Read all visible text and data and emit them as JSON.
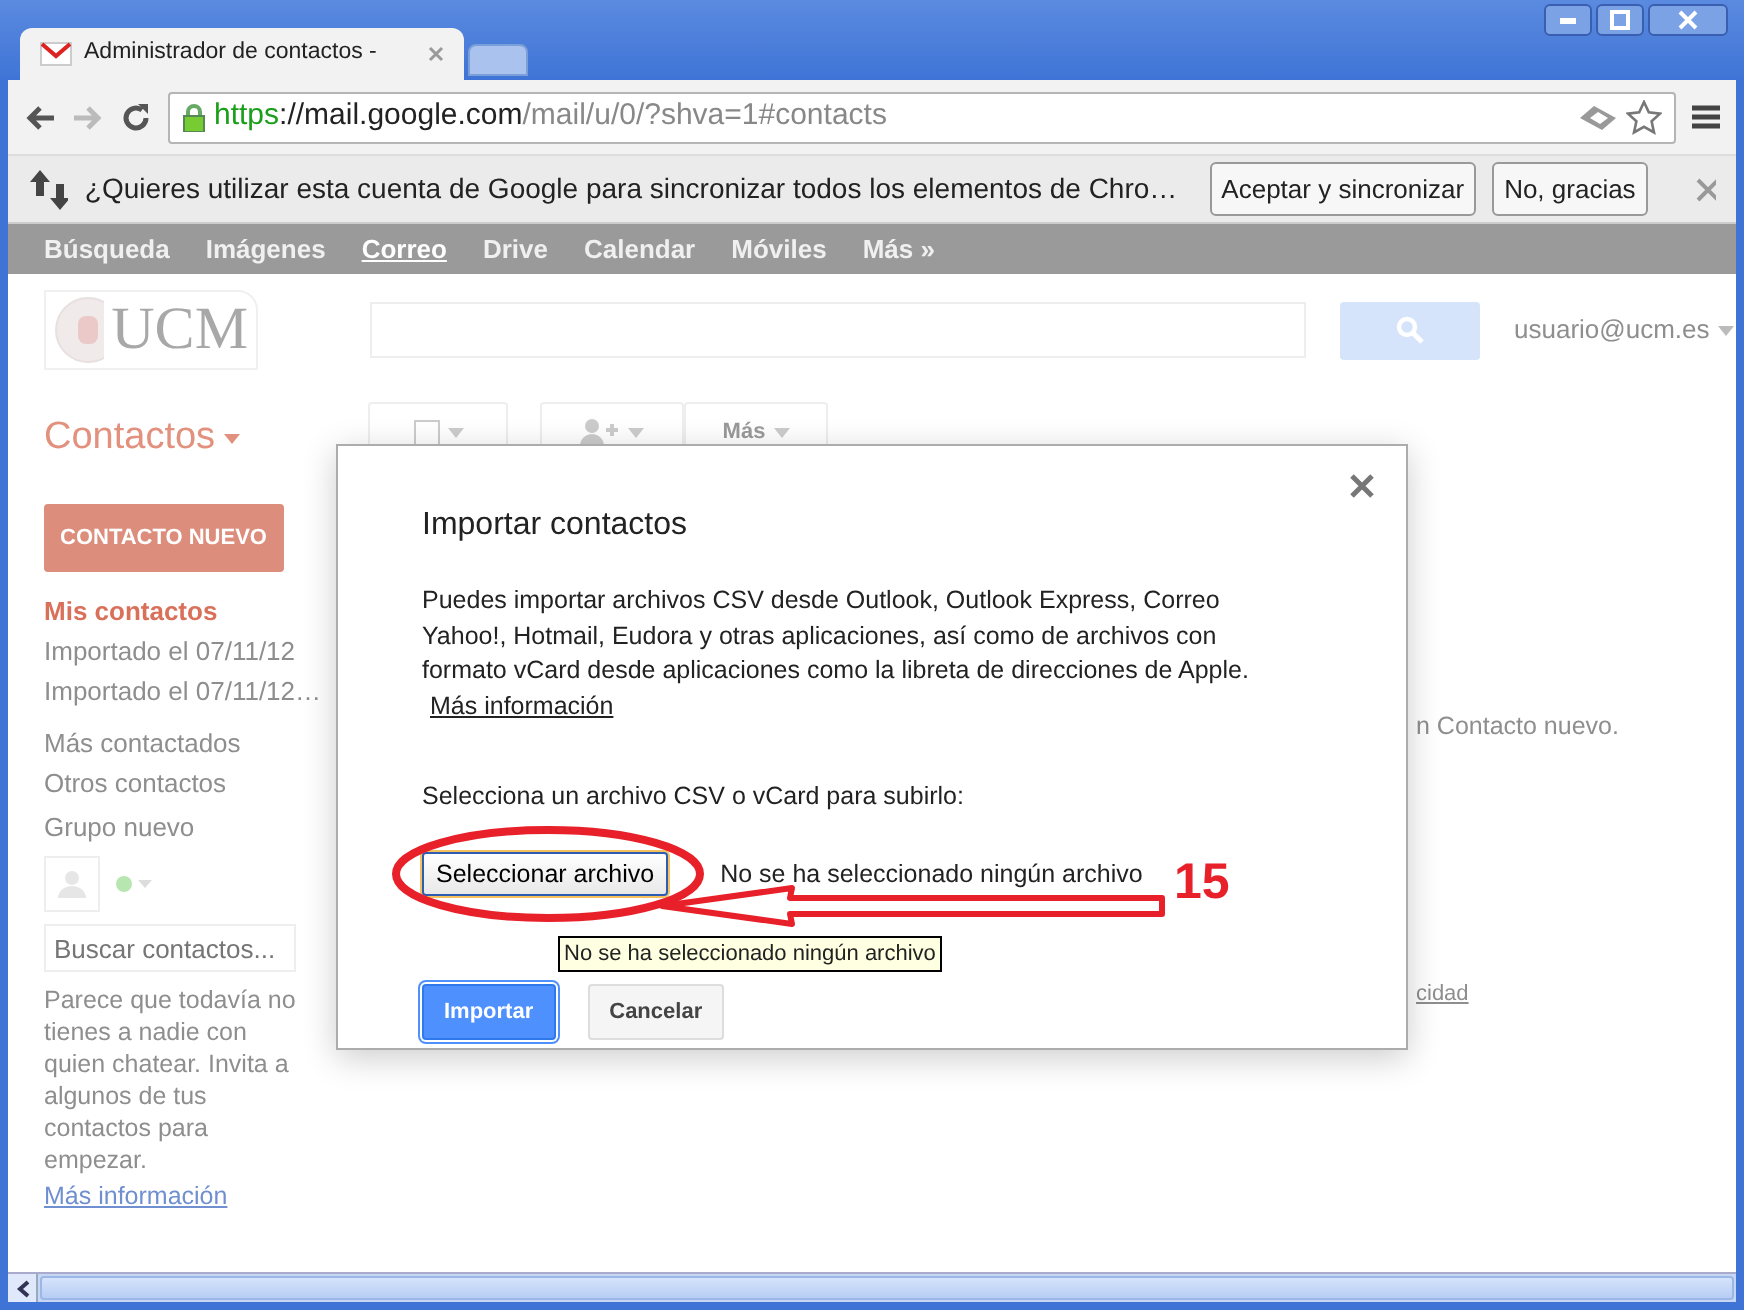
{
  "tabs": [
    {
      "label": "Administrador de contactos -",
      "selected": true
    }
  ],
  "address_bar": {
    "scheme": "https",
    "host": "://mail.google.com",
    "path": "/mail/u/0/?shva=1#contacts"
  },
  "infobar": {
    "message": "¿Quieres utilizar esta cuenta de Google para sincronizar todos los elementos de Chro…",
    "buttons": [
      "Aceptar y sincronizar",
      "No, gracias"
    ]
  },
  "google_bar": [
    {
      "label": "Búsqueda",
      "selected": false
    },
    {
      "label": "Imágenes",
      "selected": false
    },
    {
      "label": "Correo",
      "selected": true
    },
    {
      "label": "Drive",
      "selected": false
    },
    {
      "label": "Calendar",
      "selected": false
    },
    {
      "label": "Móviles",
      "selected": false
    },
    {
      "label": "Más »",
      "selected": false
    }
  ],
  "header": {
    "logo": "UCM",
    "account": "usuario@ucm.es"
  },
  "toolbar": {
    "more": "Más"
  },
  "sidebar": {
    "title": "Contactos",
    "new_button": "CONTACTO NUEVO",
    "items": [
      {
        "label": "Mis contactos",
        "selected": true
      },
      {
        "label": "Importado el 07/11/12",
        "selected": false
      },
      {
        "label": "Importado el 07/11/12…",
        "selected": false
      },
      {
        "label": "Más contactados",
        "selected": false
      },
      {
        "label": "Otros contactos",
        "selected": false
      },
      {
        "label": "Grupo nuevo",
        "selected": false
      }
    ],
    "chat_search_placeholder": "Buscar contactos...",
    "chat_message": "Parece que todavía no tienes a nadie con quien chatear. Invita a algunos de tus contactos para empezar.",
    "chat_link": "Más información"
  },
  "background_texts": [
    "n Contacto nuevo.",
    "cidad"
  ],
  "dialog": {
    "title": "Importar contactos",
    "description": "Puedes importar archivos CSV desde Outlook, Outlook Express, Correo Yahoo!, Hotmail, Eudora y otras aplicaciones, así como de archivos con formato vCard desde aplicaciones como la libreta de direcciones de Apple.",
    "link": "Más información",
    "file_label": "Selecciona un archivo CSV o vCard para subirlo:",
    "file_button": "Seleccionar archivo",
    "file_status": "No se ha seleccionado ningún archivo",
    "tooltip": "No se ha seleccionado ningún archivo",
    "buttons": [
      {
        "label": "Importar",
        "kind": "primary"
      },
      {
        "label": "Cancelar",
        "kind": "secondary"
      }
    ]
  },
  "annotation": {
    "label": "15"
  }
}
